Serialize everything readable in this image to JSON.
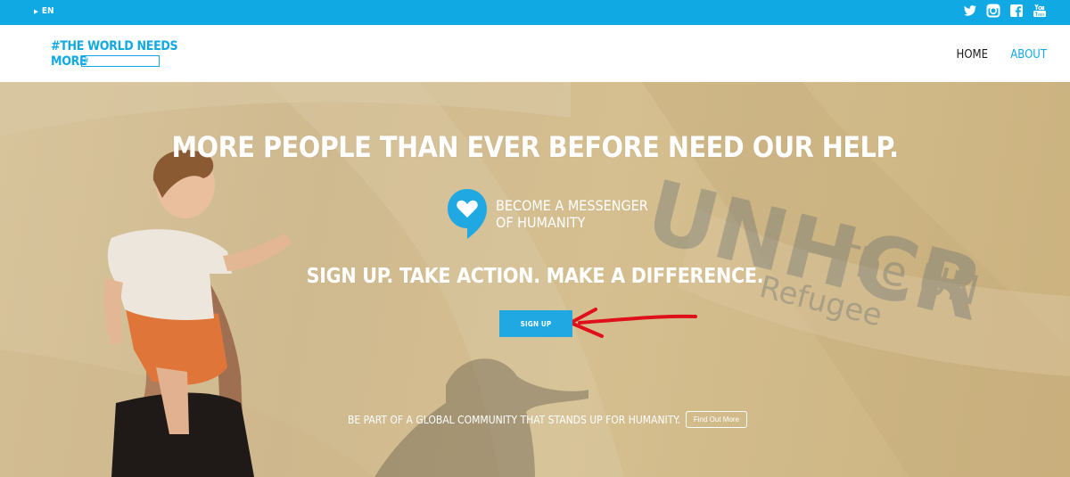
{
  "topbar": {
    "language": "EN",
    "social_icons": [
      "twitter-icon",
      "instagram-icon",
      "facebook-icon",
      "youtube-icon"
    ],
    "color": "#11a9e3"
  },
  "header": {
    "logo_line1": "#THE WORLD NEEDS",
    "logo_line2": "MORE",
    "logo_box": "#",
    "nav": {
      "home": "HOME",
      "about": "ABOUT"
    }
  },
  "hero": {
    "headline": "MORE PEOPLE THAN EVER BEFORE NEED OUR HELP.",
    "messenger_line1": "BECOME A MESSENGER",
    "messenger_line2": "OF HUMANITY",
    "tagline": "SIGN UP. TAKE ACTION. MAKE A DIFFERENCE.",
    "signup_label": "SIGN UP",
    "community_text": "BE PART OF A GLOBAL COMMUNITY THAT STANDS UP FOR HUMANITY.",
    "find_out_label": "Find Out More",
    "tent_print": "UNHCR",
    "tent_print_sub1": "The UN",
    "tent_print_sub2": "Refugee"
  },
  "colors": {
    "accent": "#11a9e3",
    "annotation_arrow": "#e0101a"
  }
}
